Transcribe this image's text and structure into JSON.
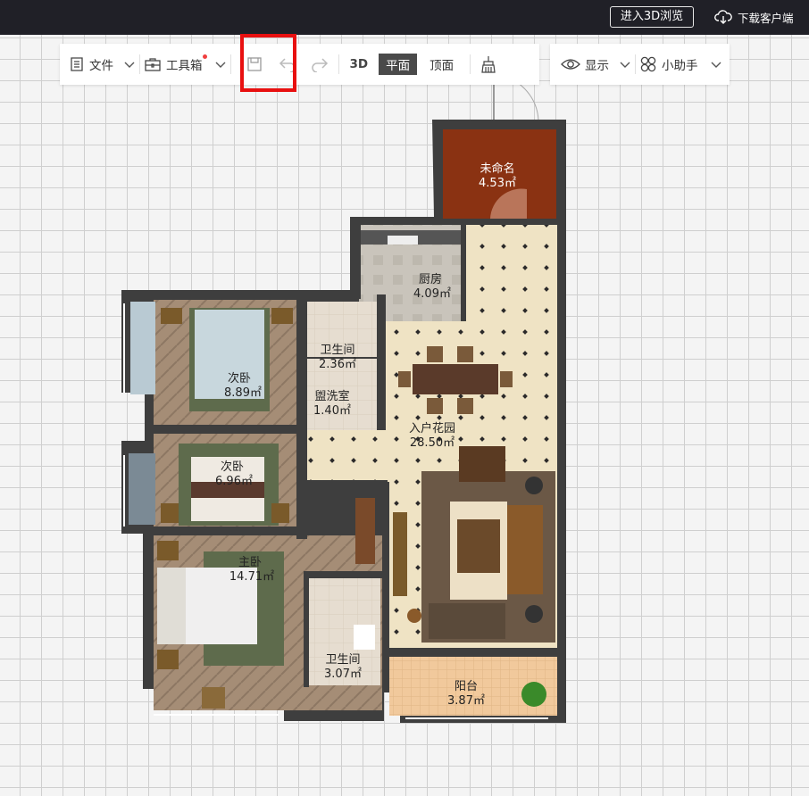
{
  "topbar": {
    "enter_3d_label": "进入3D浏览",
    "download_label": "下载客户端"
  },
  "toolbar": {
    "file_label": "文件",
    "toolbox_label": "工具箱",
    "view_3d_label": "3D",
    "view_plan_label": "平面",
    "view_ceiling_label": "顶面",
    "display_label": "显示",
    "assistant_label": "小助手"
  },
  "rooms": [
    {
      "name": "未命名",
      "area": "4.53㎡"
    },
    {
      "name": "厨房",
      "area": "4.09㎡"
    },
    {
      "name": "卫生间",
      "area": "2.36㎡"
    },
    {
      "name": "盥洗室",
      "area": "1.40㎡"
    },
    {
      "name": "次卧",
      "area": "8.89㎡"
    },
    {
      "name": "次卧",
      "area": "6.96㎡"
    },
    {
      "name": "入户花园",
      "area": "28.50㎡"
    },
    {
      "name": "主卧",
      "area": "14.71㎡"
    },
    {
      "name": "卫生间",
      "area": "3.07㎡"
    },
    {
      "name": "阳台",
      "area": "3.87㎡"
    }
  ],
  "colors": {
    "topbar": "#202027",
    "highlight": "#e81010",
    "active_view": "#4a4a4a"
  }
}
